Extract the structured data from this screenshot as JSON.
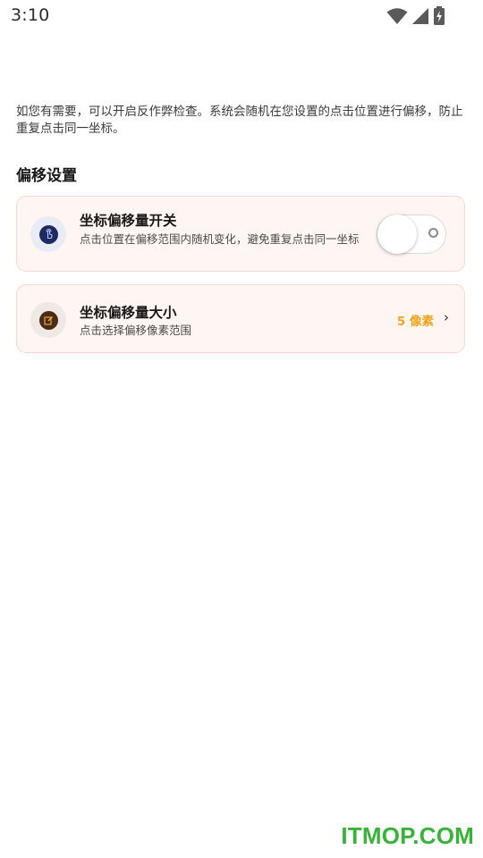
{
  "status_bar": {
    "time": "3:10",
    "icons": [
      "wifi-icon",
      "cellular-signal-icon",
      "battery-charging-icon"
    ]
  },
  "intro_text": "如您有需要，可以开启反作弊检查。系统会随机在您设置的点击位置进行偏移，防止重复点击同一坐标。",
  "section": {
    "title": "偏移设置"
  },
  "cards": [
    {
      "title": "坐标偏移量开关",
      "description": "点击位置在偏移范围内随机变化，避免重复点击同一坐标",
      "icon": "touch-icon",
      "toggle_on": false
    },
    {
      "title": "坐标偏移量大小",
      "description": "点击选择偏移像素范围",
      "icon": "edit-icon",
      "value": "5 像素",
      "chevron": "›"
    }
  ],
  "colors": {
    "card_bg": "#fff5f2",
    "card_border": "#fbd7cf",
    "accent_value": "#f0a51e",
    "icon_blue": "#1c2b63",
    "icon_brown": "#4a2b14",
    "watermark_green": "#37b33a"
  },
  "watermark": "ITMOP.COM"
}
